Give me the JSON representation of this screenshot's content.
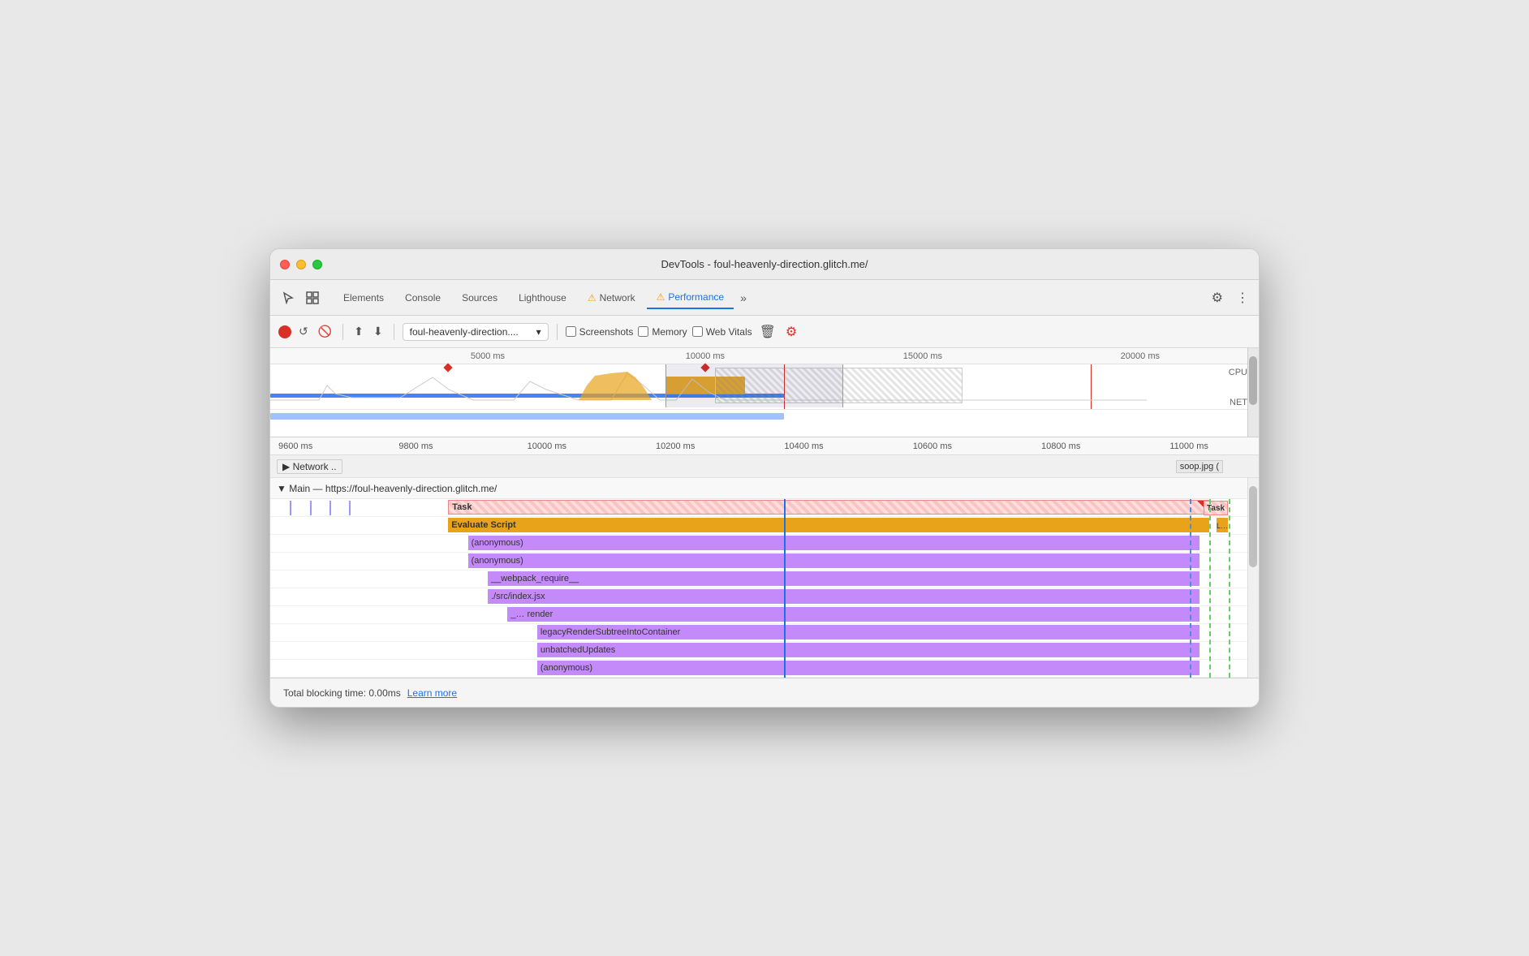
{
  "window": {
    "title": "DevTools - foul-heavenly-direction.glitch.me/"
  },
  "tabs": [
    {
      "id": "elements",
      "label": "Elements",
      "active": false,
      "warning": false
    },
    {
      "id": "console",
      "label": "Console",
      "active": false,
      "warning": false
    },
    {
      "id": "sources",
      "label": "Sources",
      "active": false,
      "warning": false
    },
    {
      "id": "lighthouse",
      "label": "Lighthouse",
      "active": false,
      "warning": false
    },
    {
      "id": "network",
      "label": "Network",
      "active": false,
      "warning": true
    },
    {
      "id": "performance",
      "label": "Performance",
      "active": true,
      "warning": true
    }
  ],
  "toolbar": {
    "more_label": "»",
    "settings_label": "⚙",
    "menu_label": "⋮",
    "url_value": "foul-heavenly-direction....",
    "screenshots_label": "Screenshots",
    "memory_label": "Memory",
    "web_vitals_label": "Web Vitals"
  },
  "timeline": {
    "ruler_ticks": [
      "5000 ms",
      "10000 ms",
      "15000 ms",
      "20000 ms"
    ],
    "bottom_ticks": [
      "9600 ms",
      "9800 ms",
      "10000 ms",
      "10200 ms",
      "10400 ms",
      "10600 ms",
      "10800 ms",
      "11000 ms",
      "1"
    ],
    "cpu_label": "CPU",
    "net_label": "NET"
  },
  "network_row": {
    "label": "▶ Network ..",
    "badge": "soop.jpg ("
  },
  "main_section": {
    "label": "▼ Main — https://foul-heavenly-direction.glitch.me/"
  },
  "flame_rows": [
    {
      "label": "Task",
      "type": "task",
      "indent": 0
    },
    {
      "label": "Evaluate Script",
      "type": "eval",
      "indent": 1
    },
    {
      "label": "(anonymous)",
      "type": "purple",
      "indent": 2
    },
    {
      "label": "(anonymous)",
      "type": "purple",
      "indent": 2
    },
    {
      "label": "__webpack_require__",
      "type": "purple",
      "indent": 3
    },
    {
      "label": "./src/index.jsx",
      "type": "purple",
      "indent": 3
    },
    {
      "label": "_…   render",
      "type": "purple",
      "indent": 4
    },
    {
      "label": "legacyRenderSubtreeIntoContainer",
      "type": "purple",
      "indent": 5
    },
    {
      "label": "unbatchedUpdates",
      "type": "purple",
      "indent": 5
    },
    {
      "label": "(anonymous)",
      "type": "purple",
      "indent": 5
    }
  ],
  "status_bar": {
    "blocking_time_label": "Total blocking time: 0.00ms",
    "learn_more_label": "Learn more"
  }
}
